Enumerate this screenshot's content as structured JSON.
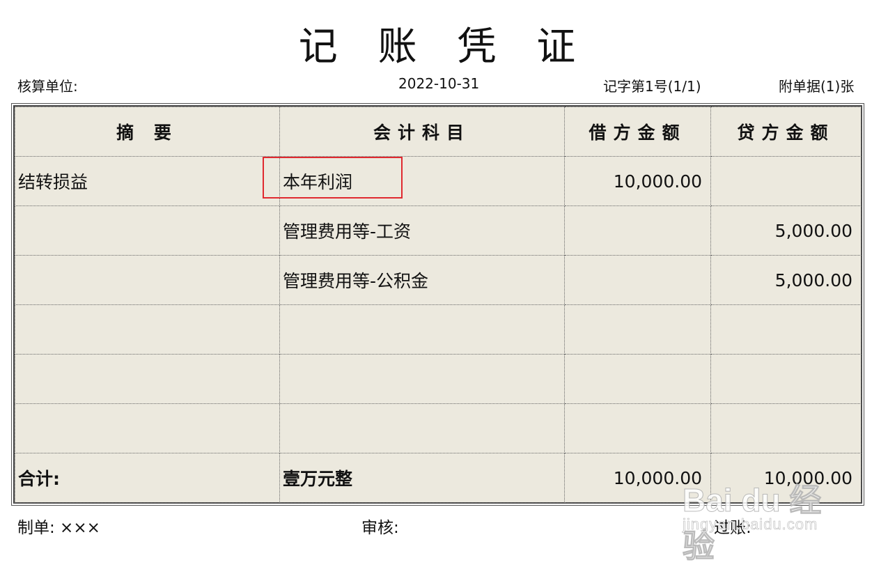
{
  "title": "记 账 凭 证",
  "meta": {
    "unit_label": "核算单位:",
    "date": "2022-10-31",
    "voucher_no": "记字第1号(1/1)",
    "attachments": "附单据(1)张"
  },
  "table": {
    "headers": {
      "summary": "摘 要",
      "account": "会计科目",
      "debit": "借方金额",
      "credit": "贷方金额"
    },
    "rows": [
      {
        "summary": "结转损益",
        "account": "本年利润",
        "debit": "10,000.00",
        "credit": ""
      },
      {
        "summary": "",
        "account": "管理费用等-工资",
        "debit": "",
        "credit": "5,000.00"
      },
      {
        "summary": "",
        "account": "管理费用等-公积金",
        "debit": "",
        "credit": "5,000.00"
      },
      {
        "summary": "",
        "account": "",
        "debit": "",
        "credit": ""
      },
      {
        "summary": "",
        "account": "",
        "debit": "",
        "credit": ""
      },
      {
        "summary": "",
        "account": "",
        "debit": "",
        "credit": ""
      }
    ],
    "total": {
      "label": "合计:",
      "amount_words": "壹万元整",
      "debit": "10,000.00",
      "credit": "10,000.00"
    }
  },
  "footer": {
    "prepared_by": "制单: ×××",
    "reviewed_by": "审核:",
    "posted_by": "过账:"
  },
  "watermark": {
    "logo": "Bai du 经验",
    "url": "jingyan.baidu.com"
  },
  "colors": {
    "table_bg": "#ece9de",
    "highlight": "#e0292f"
  }
}
